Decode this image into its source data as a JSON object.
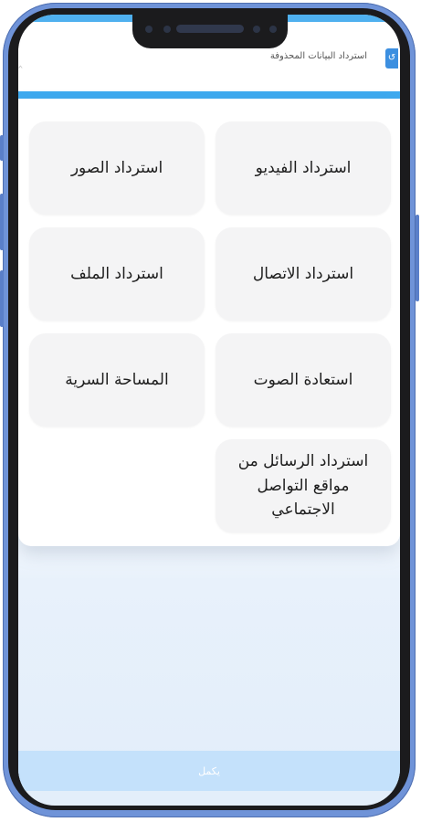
{
  "header": {
    "title": "استرداد البيانات المحذوفة",
    "app_icon": "app-icon",
    "collapse_icon": "chevron-up-icon"
  },
  "tiles": [
    {
      "label": "استرداد الفيديو"
    },
    {
      "label": "استرداد الصور"
    },
    {
      "label": "استرداد الاتصال"
    },
    {
      "label": "استرداد الملف"
    },
    {
      "label": "استعادة الصوت"
    },
    {
      "label": "المساحة السرية"
    },
    {
      "label": "استرداد الرسائل من مواقع التواصل الاجتماعي"
    }
  ],
  "footer": {
    "label": "يكمل"
  },
  "colors": {
    "accent": "#3daaf0",
    "tile_bg": "#f4f4f5",
    "footer_bg": "#c4e1fb",
    "frame": "#6f93d8"
  }
}
